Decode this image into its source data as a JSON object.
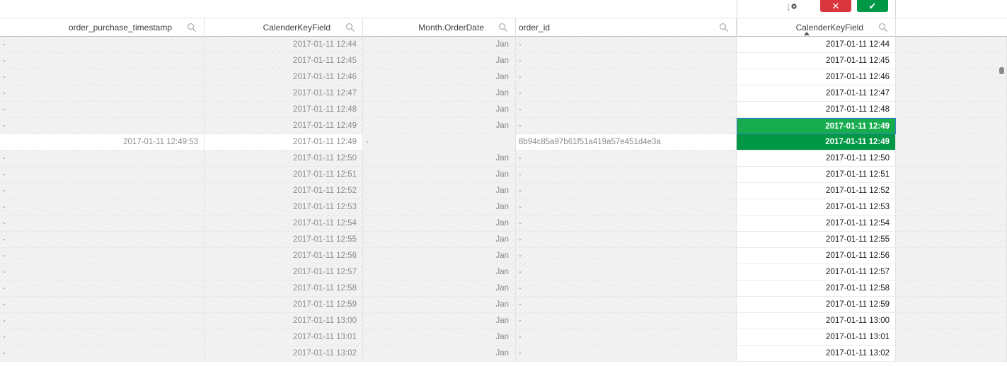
{
  "toolbar": {
    "clear_icon": "clear-selection-icon",
    "cancel_icon": "✕",
    "confirm_icon": "✔"
  },
  "columns": [
    {
      "name": "order_purchase_timestamp"
    },
    {
      "name": "CalenderKeyField"
    },
    {
      "name": "Month.OrderDate"
    },
    {
      "name": "order_id"
    },
    {
      "name": "CalenderKeyField"
    }
  ],
  "rows": [
    {
      "ts": "-",
      "key": "2017-01-11 12:44",
      "month": "Jan",
      "order_id": "-",
      "key2": "2017-01-11 12:44",
      "state": "normal"
    },
    {
      "ts": "-",
      "key": "2017-01-11 12:45",
      "month": "Jan",
      "order_id": "-",
      "key2": "2017-01-11 12:45",
      "state": "normal"
    },
    {
      "ts": "-",
      "key": "2017-01-11 12:46",
      "month": "Jan",
      "order_id": "-",
      "key2": "2017-01-11 12:46",
      "state": "normal"
    },
    {
      "ts": "-",
      "key": "2017-01-11 12:47",
      "month": "Jan",
      "order_id": "-",
      "key2": "2017-01-11 12:47",
      "state": "normal"
    },
    {
      "ts": "-",
      "key": "2017-01-11 12:48",
      "month": "Jan",
      "order_id": "-",
      "key2": "2017-01-11 12:48",
      "state": "normal"
    },
    {
      "ts": "-",
      "key": "2017-01-11 12:49",
      "month": "Jan",
      "order_id": "-",
      "key2": "2017-01-11 12:49",
      "state": "selected-light"
    },
    {
      "ts": "2017-01-11 12:49:53",
      "key": "2017-01-11 12:49",
      "month": "-",
      "order_id": "8b94c85a97b61f51a419a57e451d4e3a",
      "key2": "2017-01-11 12:49",
      "state": "selected-dark"
    },
    {
      "ts": "-",
      "key": "2017-01-11 12:50",
      "month": "Jan",
      "order_id": "-",
      "key2": "2017-01-11 12:50",
      "state": "normal"
    },
    {
      "ts": "-",
      "key": "2017-01-11 12:51",
      "month": "Jan",
      "order_id": "-",
      "key2": "2017-01-11 12:51",
      "state": "normal"
    },
    {
      "ts": "-",
      "key": "2017-01-11 12:52",
      "month": "Jan",
      "order_id": "-",
      "key2": "2017-01-11 12:52",
      "state": "normal"
    },
    {
      "ts": "-",
      "key": "2017-01-11 12:53",
      "month": "Jan",
      "order_id": "-",
      "key2": "2017-01-11 12:53",
      "state": "normal"
    },
    {
      "ts": "-",
      "key": "2017-01-11 12:54",
      "month": "Jan",
      "order_id": "-",
      "key2": "2017-01-11 12:54",
      "state": "normal"
    },
    {
      "ts": "-",
      "key": "2017-01-11 12:55",
      "month": "Jan",
      "order_id": "-",
      "key2": "2017-01-11 12:55",
      "state": "normal"
    },
    {
      "ts": "-",
      "key": "2017-01-11 12:56",
      "month": "Jan",
      "order_id": "-",
      "key2": "2017-01-11 12:56",
      "state": "normal"
    },
    {
      "ts": "-",
      "key": "2017-01-11 12:57",
      "month": "Jan",
      "order_id": "-",
      "key2": "2017-01-11 12:57",
      "state": "normal"
    },
    {
      "ts": "-",
      "key": "2017-01-11 12:58",
      "month": "Jan",
      "order_id": "-",
      "key2": "2017-01-11 12:58",
      "state": "normal"
    },
    {
      "ts": "-",
      "key": "2017-01-11 12:59",
      "month": "Jan",
      "order_id": "-",
      "key2": "2017-01-11 12:59",
      "state": "normal"
    },
    {
      "ts": "-",
      "key": "2017-01-11 13:00",
      "month": "Jan",
      "order_id": "-",
      "key2": "2017-01-11 13:00",
      "state": "normal"
    },
    {
      "ts": "-",
      "key": "2017-01-11 13:01",
      "month": "Jan",
      "order_id": "-",
      "key2": "2017-01-11 13:01",
      "state": "normal"
    },
    {
      "ts": "-",
      "key": "2017-01-11 13:02",
      "month": "Jan",
      "order_id": "-",
      "key2": "2017-01-11 13:02",
      "state": "normal"
    }
  ],
  "colors": {
    "selected": "#009845",
    "selected_light": "#17ad4e",
    "excluded": "#efefef",
    "cancel": "#d9363e"
  }
}
